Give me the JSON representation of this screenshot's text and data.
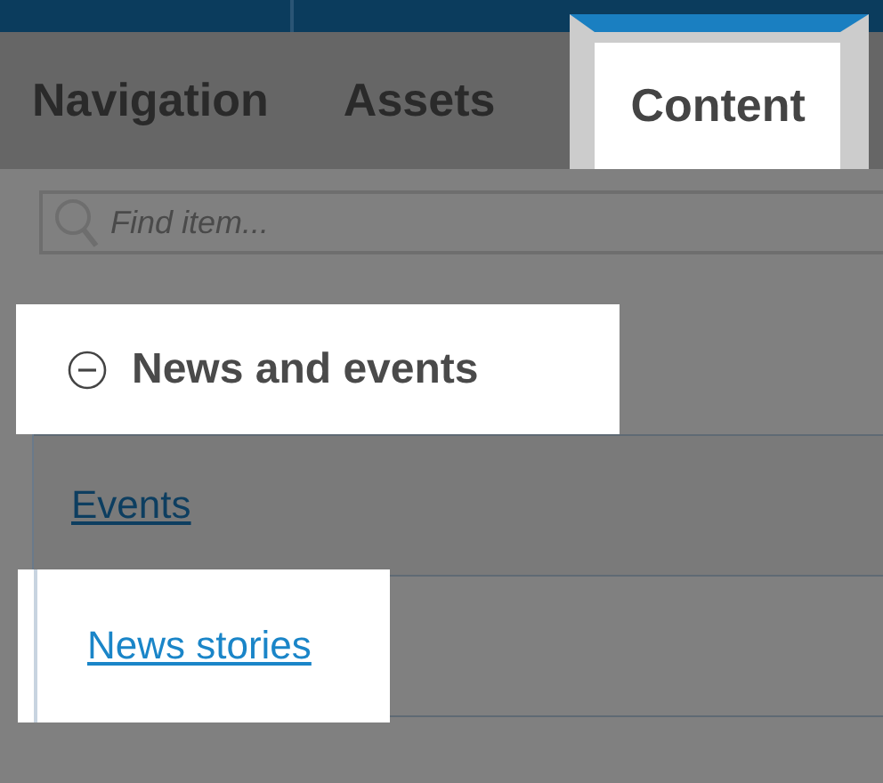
{
  "tabs": [
    {
      "label": "Navigation",
      "selected": false,
      "highlighted": false
    },
    {
      "label": "Assets",
      "selected": false,
      "highlighted": false
    },
    {
      "label": "Content",
      "selected": true,
      "highlighted": true
    }
  ],
  "search": {
    "placeholder": "Find item..."
  },
  "section": {
    "title": "News and events",
    "expanded": true,
    "highlighted": true,
    "items": [
      {
        "label": "Events",
        "highlighted": false
      },
      {
        "label": "News stories",
        "highlighted": true
      }
    ]
  }
}
